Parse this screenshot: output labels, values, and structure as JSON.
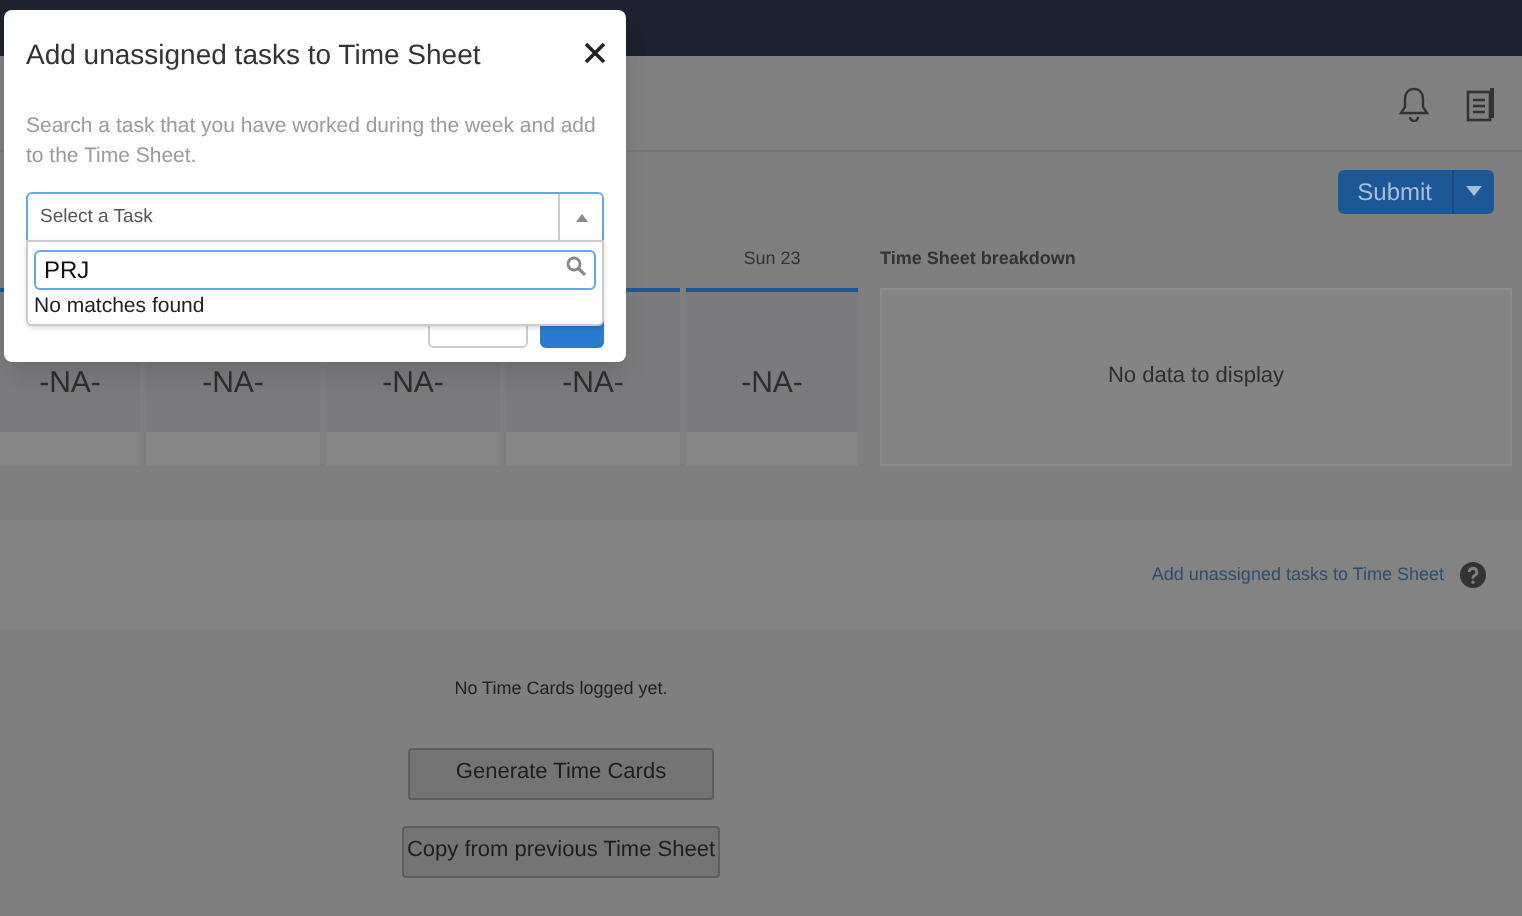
{
  "header": {
    "submit_button": "Submit"
  },
  "days": [
    {
      "value": "-NA-"
    },
    {
      "value": "-NA-"
    },
    {
      "value": "-NA-"
    },
    {
      "value": "-NA-"
    },
    {
      "label": "Sun 23",
      "value": "-NA-"
    }
  ],
  "breakdown": {
    "title": "Time Sheet breakdown",
    "empty_text": "No data to display"
  },
  "add_link": "Add unassigned tasks to Time Sheet",
  "time_cards": {
    "empty_text": "No Time Cards logged yet.",
    "buttons": [
      "Generate Time Cards",
      "Copy from previous Time Sheet"
    ]
  },
  "modal": {
    "title": "Add unassigned tasks to Time Sheet",
    "description": "Search a task that you have worked during the week and add to the Time Sheet.",
    "select": {
      "placeholder": "Select a Task",
      "expanded": true
    },
    "search": {
      "value": "PRJ"
    },
    "no_results": "No matches found"
  }
}
